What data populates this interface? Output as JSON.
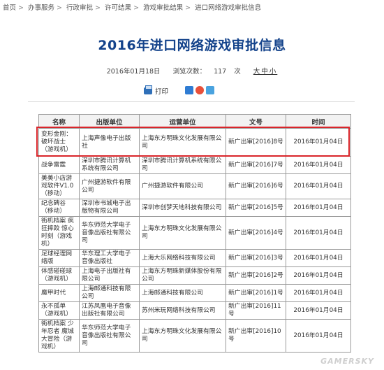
{
  "breadcrumb": [
    "首页",
    "办事服务",
    "行政审批",
    "许可结果",
    "游戏审批结果",
    "进口网络游戏审批信息"
  ],
  "page_title": "2016年进口网络游戏审批信息",
  "meta": {
    "date": "2016年01月18日",
    "views_label": "浏览次数：",
    "views": "117",
    "views_unit": "次",
    "font_size": "大中小"
  },
  "tools": {
    "print_label": "打印"
  },
  "table": {
    "headers": [
      "名称",
      "出版单位",
      "运营单位",
      "文号",
      "时间"
    ],
    "rows": [
      [
        "变形金刚：破坏战士（游戏机）",
        "上海声像电子出版社",
        "上海东方明珠文化发展有限公司",
        "新广出审[2016]8号",
        "2016年01月04日"
      ],
      [
        "战争雷霆",
        "深圳市腾讯计算机系统有限公司",
        "深圳市腾讯计算机系统有限公司",
        "新广出审[2016]7号",
        "2016年01月04日"
      ],
      [
        "美美小店游戏软件V1.0（移动）",
        "广州捷游软件有限公司",
        "广州捷游软件有限公司",
        "新广出审[2016]6号",
        "2016年01月04日"
      ],
      [
        "纪念碑谷（移动）",
        "深圳市书城电子出版物有限公司",
        "深圳市创梦天地科技有限公司",
        "新广出审[2016]5号",
        "2016年01月04日"
      ],
      [
        "街机档案 疯狂摔跤 惊心时刻（游戏机）",
        "华东师范大学电子音像出版社有限公司",
        "上海东方明珠文化发展有限公司",
        "新广出审[2016]4号",
        "2016年01月04日"
      ],
      [
        "足球经理网络版",
        "华东理工大学电子音像出版社",
        "上海大乐网络科技有限公司",
        "新广出审[2016]3号",
        "2016年01月04日"
      ],
      [
        "体感碰碰球（游戏机）",
        "上海电子出版社有限公司",
        "上海东方明珠新媒体股份有限公司",
        "新广出审[2016]2号",
        "2016年01月04日"
      ],
      [
        "魔甲时代",
        "上海邮通科技有限公司",
        "上海邮通科技有限公司",
        "新广出审[2016]1号",
        "2016年01月04日"
      ],
      [
        "永不孤单（游戏机）",
        "江苏凤凰电子音像出版社有限公司",
        "苏州米玩网络科技有限公司",
        "新广出审[2016]11号",
        "2016年01月04日"
      ],
      [
        "街机档案 少年忍者 魔城大冒险（游戏机）",
        "华东师范大学电子音像出版社有限公司",
        "上海东方明珠文化发展有限公司",
        "新广出审[2016]10号",
        "2016年01月04日"
      ]
    ]
  },
  "watermark": "GAMERSKY",
  "colors": {
    "title": "#14438b",
    "highlight": "#d9252a"
  }
}
